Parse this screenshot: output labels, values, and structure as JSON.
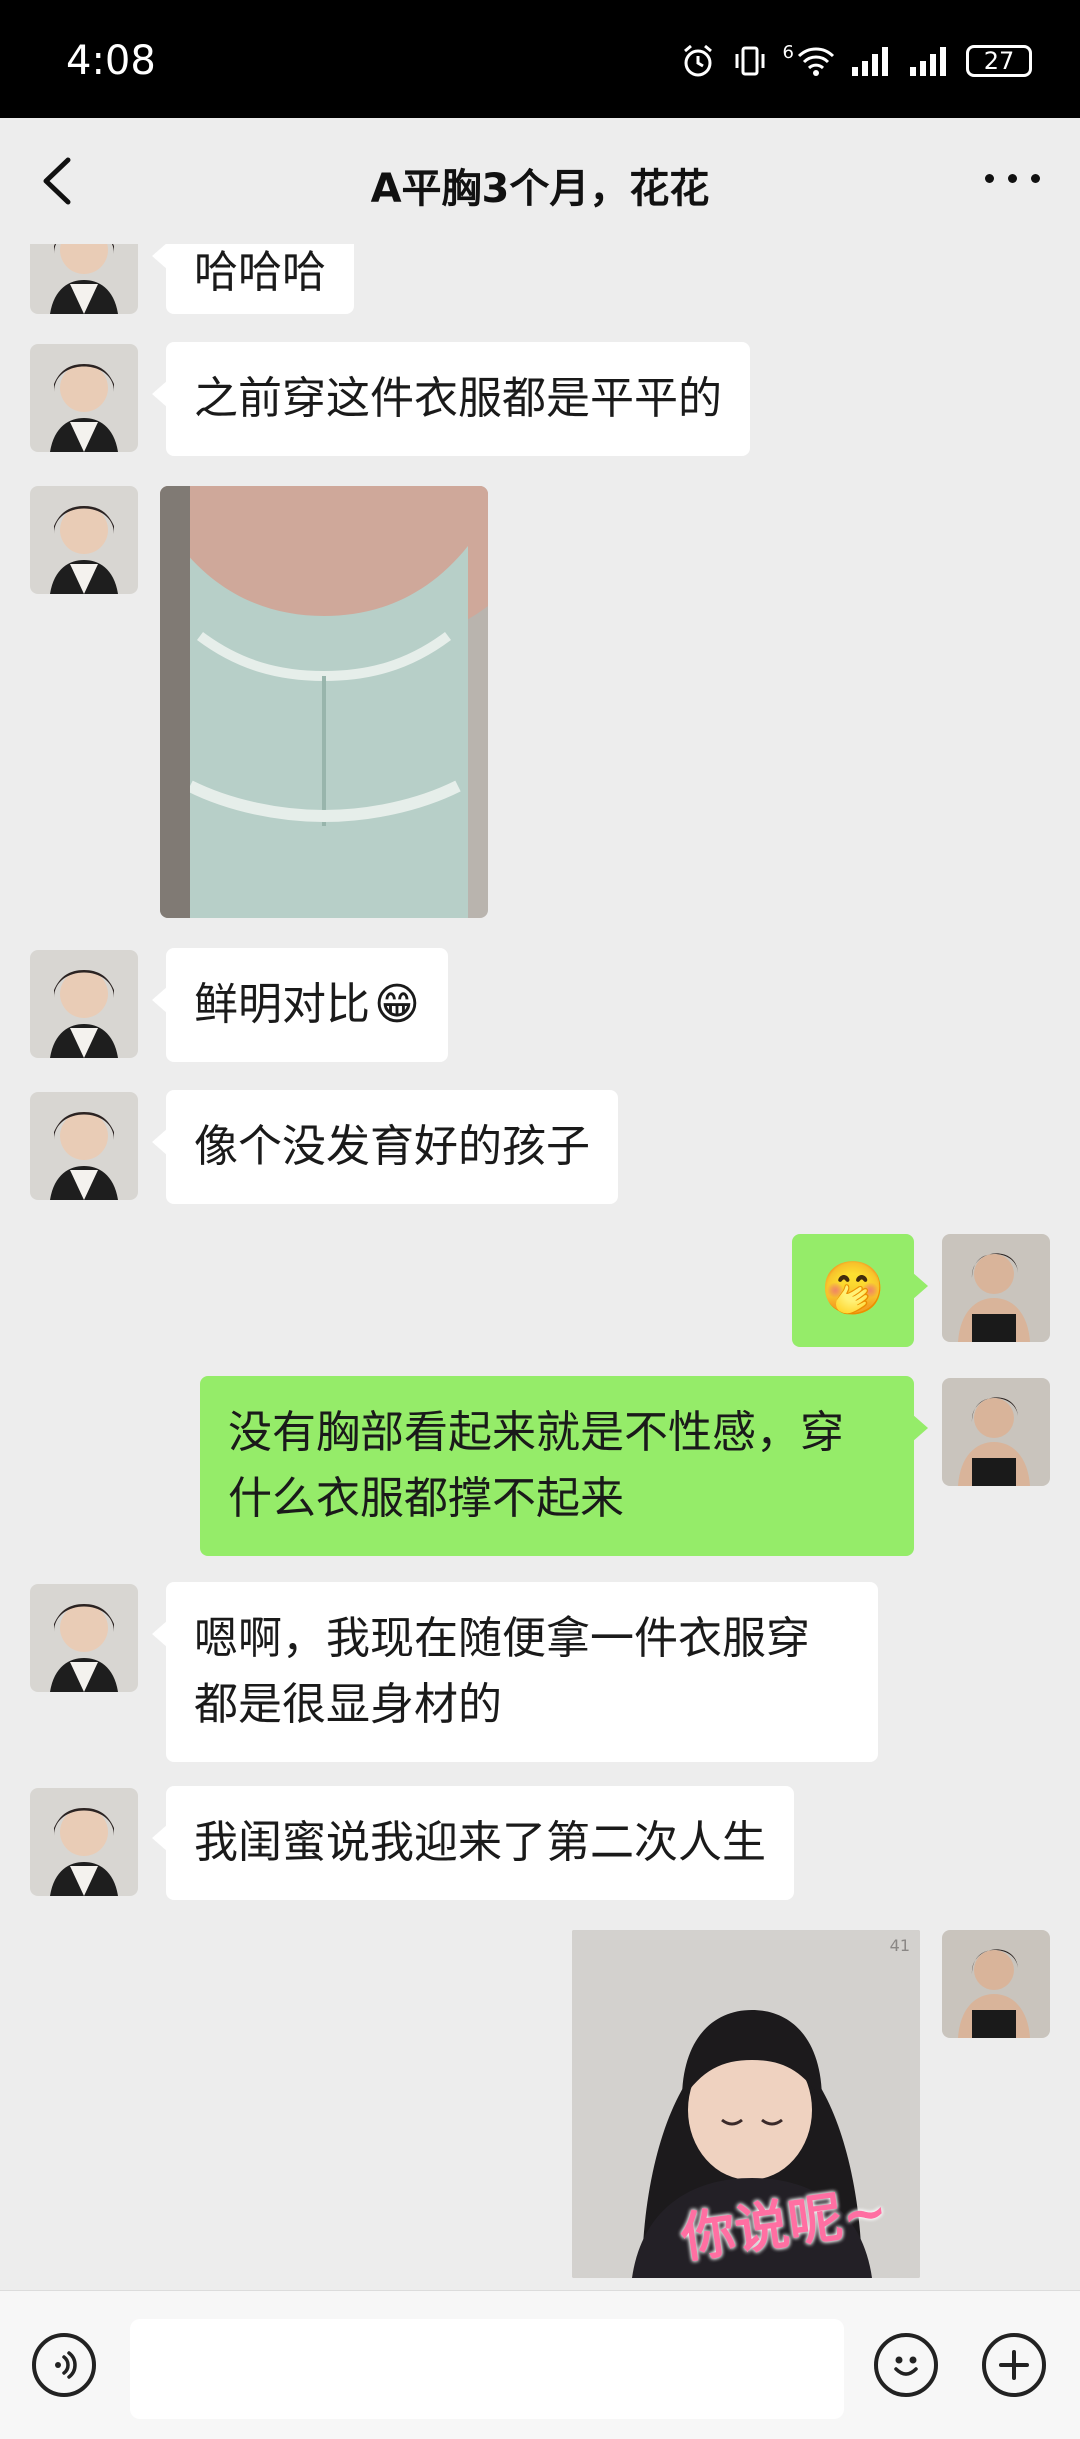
{
  "status_bar": {
    "time": "4:08",
    "signal_label": "6",
    "battery": "27"
  },
  "header": {
    "title": "A平胸3个月，花花"
  },
  "messages": {
    "m0": "哈哈哈",
    "m1": "之前穿这件衣服都是平平的",
    "m3": "鲜明对比",
    "m4": "像个没发育好的孩子",
    "m6": "没有胸部看起来就是不性感，穿什么衣服都撑不起来",
    "m7": "嗯啊，我现在随便拿一件衣服穿都是很显身材的",
    "m8": "我闺蜜说我迎来了第二次人生",
    "m9_sticker_caption": "你说呢~",
    "m9_sticker_counter": "41"
  },
  "emoji": {
    "grin": "😁",
    "giggle": "🤭"
  },
  "input": {
    "value": "",
    "placeholder": ""
  }
}
